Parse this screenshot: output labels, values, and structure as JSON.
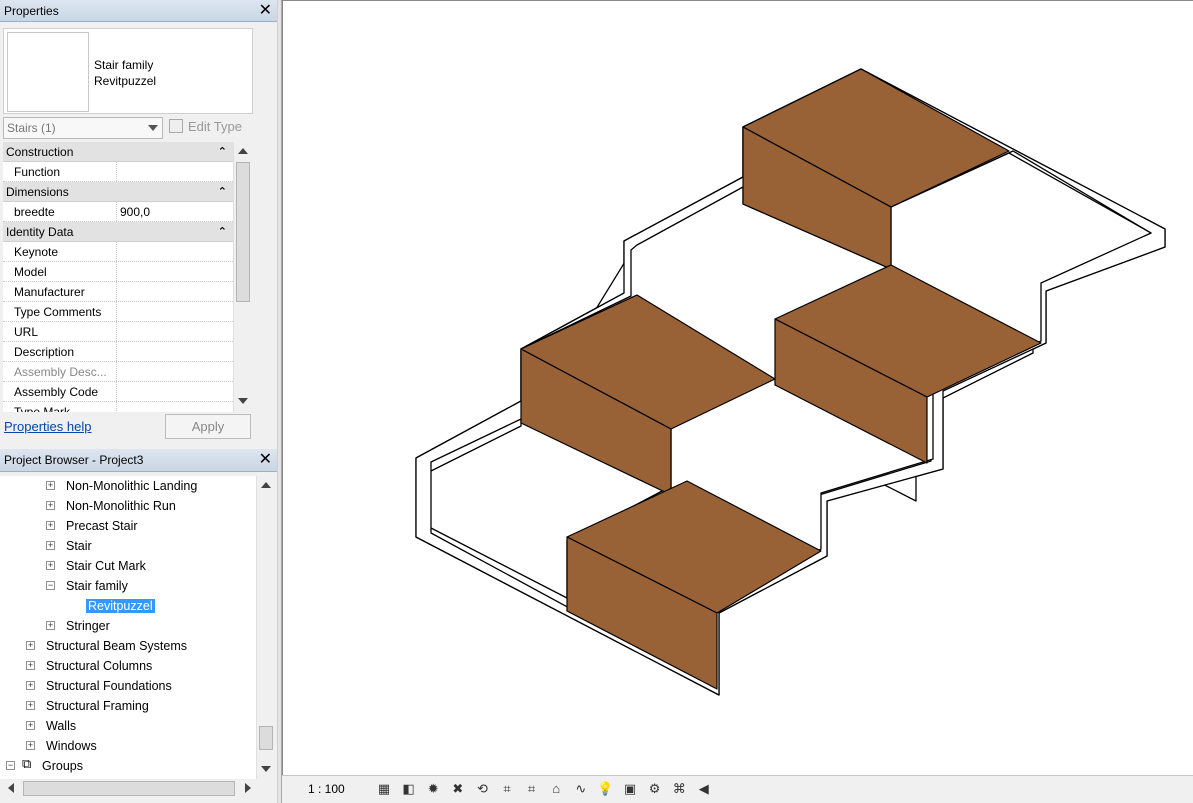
{
  "properties": {
    "title": "Properties",
    "close_label": "✕",
    "type_name_line1": "Stair family",
    "type_name_line2": "Revitpuzzel",
    "type_selector": "Stairs (1)",
    "edit_type_label": "Edit Type",
    "groups": [
      {
        "name": "Construction",
        "rows": [
          {
            "key": "Function",
            "value": ""
          }
        ]
      },
      {
        "name": "Dimensions",
        "rows": [
          {
            "key": "breedte",
            "value": "900,0"
          }
        ]
      },
      {
        "name": "Identity Data",
        "rows": [
          {
            "key": "Keynote",
            "value": ""
          },
          {
            "key": "Model",
            "value": ""
          },
          {
            "key": "Manufacturer",
            "value": ""
          },
          {
            "key": "Type Comments",
            "value": ""
          },
          {
            "key": "URL",
            "value": ""
          },
          {
            "key": "Description",
            "value": ""
          },
          {
            "key": "Assembly Desc...",
            "value": ""
          },
          {
            "key": "Assembly Code",
            "value": ""
          },
          {
            "key": "Type Mark",
            "value": ""
          }
        ]
      }
    ],
    "help_link": "Properties help",
    "apply_label": "Apply"
  },
  "browser": {
    "title": "Project Browser - Project3",
    "close_label": "✕",
    "nodes": [
      {
        "label": "Non-Monolithic Landing",
        "toggle": "+",
        "level": 2
      },
      {
        "label": "Non-Monolithic Run",
        "toggle": "+",
        "level": 2
      },
      {
        "label": "Precast Stair",
        "toggle": "+",
        "level": 2
      },
      {
        "label": "Stair",
        "toggle": "+",
        "level": 2
      },
      {
        "label": "Stair Cut Mark",
        "toggle": "+",
        "level": 2
      },
      {
        "label": "Stair family",
        "toggle": "−",
        "level": 2
      },
      {
        "label": "Revitpuzzel",
        "toggle": "",
        "level": 3,
        "selected": true
      },
      {
        "label": "Stringer",
        "toggle": "+",
        "level": 2
      },
      {
        "label": "Structural Beam Systems",
        "toggle": "+",
        "level": 1
      },
      {
        "label": "Structural Columns",
        "toggle": "+",
        "level": 1
      },
      {
        "label": "Structural Foundations",
        "toggle": "+",
        "level": 1
      },
      {
        "label": "Structural Framing",
        "toggle": "+",
        "level": 1
      },
      {
        "label": "Walls",
        "toggle": "+",
        "level": 1
      },
      {
        "label": "Windows",
        "toggle": "+",
        "level": 1
      },
      {
        "label": "Groups",
        "toggle": "−",
        "level": 0,
        "icon": true
      }
    ]
  },
  "view_control_bar": {
    "scale": "1 : 100",
    "icons": [
      "detail-level-icon",
      "visual-style-icon",
      "sun-path-icon",
      "shadows-icon",
      "render-icon",
      "crop-view-icon",
      "show-crop-icon",
      "unlock-3d-icon",
      "temporary-hide-icon",
      "reveal-hidden-icon",
      "temporary-view-properties-icon",
      "analytical-model-icon",
      "highlight-displacement-icon",
      "worksharing-display-icon"
    ],
    "icon_glyphs": [
      "▦",
      "◧",
      "✹",
      "✖",
      "⟲",
      "⌗",
      "⌗",
      "⌂",
      "∿",
      "💡",
      "▣",
      "⚙",
      "⌘",
      "◀"
    ]
  },
  "colors": {
    "stair_fill": "#996236",
    "selection": "#3399ff"
  }
}
